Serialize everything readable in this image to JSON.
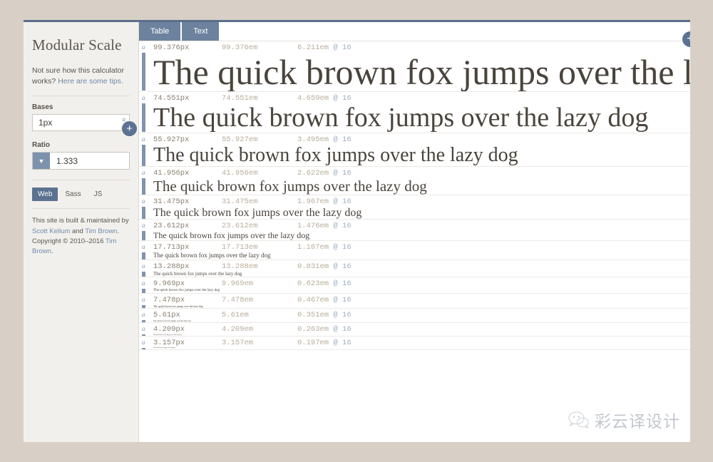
{
  "sidebar": {
    "title": "Modular Scale",
    "tips_text_before": "Not sure how this calculator works? ",
    "tips_link": "Here are some tips.",
    "bases_label": "Bases",
    "bases_value": "1px",
    "bases_superscript": "a",
    "add_base_icon": "plus-icon",
    "ratio_label": "Ratio",
    "ratio_value": "1.333",
    "ratio_dropdown_icon": "chevron-down-icon",
    "output_tabs": [
      {
        "label": "Web",
        "active": true
      },
      {
        "label": "Sass",
        "active": false
      },
      {
        "label": "JS",
        "active": false
      }
    ],
    "credit": {
      "part1": "This site is built & maintained by ",
      "link1": "Scott Kellum",
      "part2": " and ",
      "link2": "Tim Brown",
      "part3": ". Copyright © 2010–2016 ",
      "link3": "Tim Brown",
      "part4": "."
    }
  },
  "main": {
    "tabs": [
      {
        "label": "Table",
        "active": true
      },
      {
        "label": "Text",
        "active": false
      }
    ],
    "add_button_icon": "plus-icon",
    "sample_text": "The quick brown fox jumps over the lazy dog",
    "rows": [
      {
        "px": "99.376px",
        "em": "99.376em",
        "rem": "6.211em",
        "at": "@ 16",
        "size": 50
      },
      {
        "px": "74.551px",
        "em": "74.551em",
        "rem": "4.659em",
        "at": "@ 16",
        "size": 38
      },
      {
        "px": "55.927px",
        "em": "55.927em",
        "rem": "3.495em",
        "at": "@ 16",
        "size": 28
      },
      {
        "px": "41.956px",
        "em": "41.956em",
        "rem": "2.622em",
        "at": "@ 16",
        "size": 21
      },
      {
        "px": "31.475px",
        "em": "31.475em",
        "rem": "1.967em",
        "at": "@ 16",
        "size": 16
      },
      {
        "px": "23.612px",
        "em": "23.612em",
        "rem": "1.476em",
        "at": "@ 16",
        "size": 12
      },
      {
        "px": "17.713px",
        "em": "17.713em",
        "rem": "1.107em",
        "at": "@ 16",
        "size": 9
      },
      {
        "px": "13.288px",
        "em": "13.288em",
        "rem": "0.831em",
        "at": "@ 16",
        "size": 6.8
      },
      {
        "px": "9.969px",
        "em": "9.969em",
        "rem": "0.623em",
        "at": "@ 16",
        "size": 5.1
      },
      {
        "px": "7.478px",
        "em": "7.478em",
        "rem": "0.467em",
        "at": "@ 16",
        "size": 3.8
      },
      {
        "px": "5.61px",
        "em": "5.61em",
        "rem": "0.351em",
        "at": "@ 16",
        "size": 2.9
      },
      {
        "px": "4.209px",
        "em": "4.209em",
        "rem": "0.263em",
        "at": "@ 16",
        "size": 2.2
      },
      {
        "px": "3.157px",
        "em": "3.157em",
        "rem": "0.197em",
        "at": "@ 16",
        "size": 1.7
      }
    ]
  },
  "watermark": {
    "text": "彩云译设计",
    "icon": "wechat-icon"
  },
  "colors": {
    "accent": "#5b7292",
    "tab": "#6c829e",
    "page_bg": "#d8cfc6",
    "sidebar_bg": "#f2f0ec",
    "link": "#6f8bab"
  }
}
